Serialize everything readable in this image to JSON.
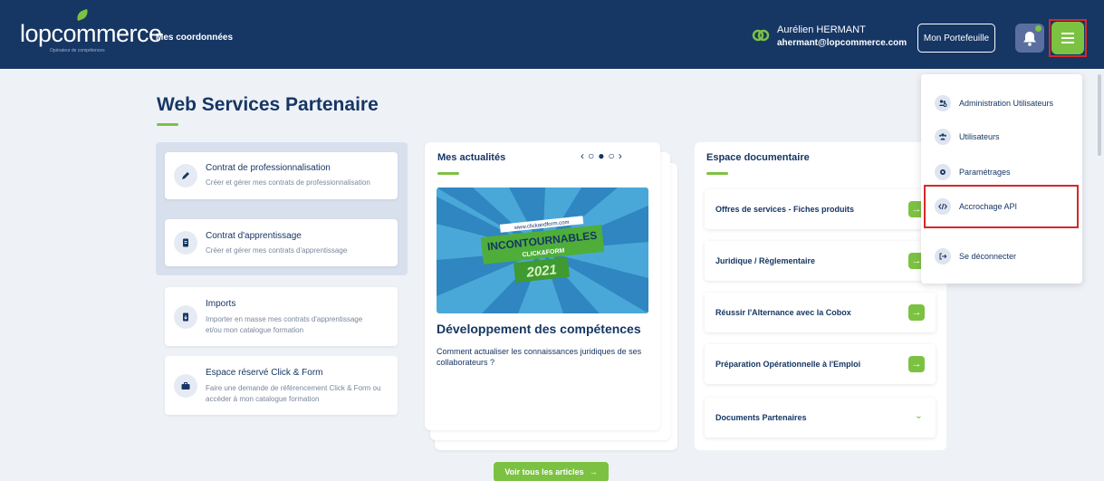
{
  "header": {
    "logo_text": "lopcommerce",
    "logo_subtitle": "Opérateur de compétences",
    "nav_link": "Mes coordonnées",
    "user_name": "Aurélien HERMANT",
    "user_email": "ahermant@lopcommerce.com",
    "portfolio_label": "Mon Portefeuille"
  },
  "main": {
    "title": "Web Services Partenaire",
    "actions": [
      {
        "title": "Contrat de professionnalisation",
        "desc": "Créer et gérer mes contrats de professionnalisation",
        "icon": "pencil-icon"
      },
      {
        "title": "Contrat d'apprentissage",
        "desc": "Créer et gérer mes contrats d'apprentissage",
        "icon": "document-icon"
      },
      {
        "title": "Imports",
        "desc1": "Importer en masse mes contrats d'apprentissage",
        "desc2": "et/ou mon catalogue formation",
        "icon": "import-icon"
      },
      {
        "title": "Espace réservé Click & Form",
        "desc1": "Faire une demande de référencement Click & Form ou",
        "desc2": "accéder à mon catalogue formation",
        "icon": "briefcase-icon"
      }
    ],
    "news": {
      "title": "Mes actualités",
      "image_url_text": "www.clickandform.com",
      "image_line1": "INCONTOURNABLES",
      "image_line2": "CLICK&FORM",
      "image_year": "2021",
      "headline": "Développement des compétences",
      "desc": "Comment actualiser les connaissances juridiques de ses collaborateurs ?",
      "see_all": "Voir tous les articles"
    },
    "docs": {
      "title": "Espace documentaire",
      "items": [
        "Offres de services - Fiches produits",
        "Juridique / Règlementaire",
        "Réussir l'Alternance avec la Cobox",
        "Préparation Opérationnelle à l'Emploi",
        "Documents Partenaires"
      ]
    }
  },
  "menu": {
    "items": [
      {
        "label": "Administration Utilisateurs",
        "icon": "users-admin-icon"
      },
      {
        "label": "Utilisateurs",
        "icon": "users-icon"
      },
      {
        "label": "Paramétrages",
        "icon": "gear-icon"
      },
      {
        "label": "Accrochage API",
        "icon": "code-icon"
      },
      {
        "label": "Se déconnecter",
        "icon": "logout-icon"
      }
    ]
  },
  "colors": {
    "navy": "#163664",
    "green": "#7cc242",
    "highlight": "#d62828"
  }
}
